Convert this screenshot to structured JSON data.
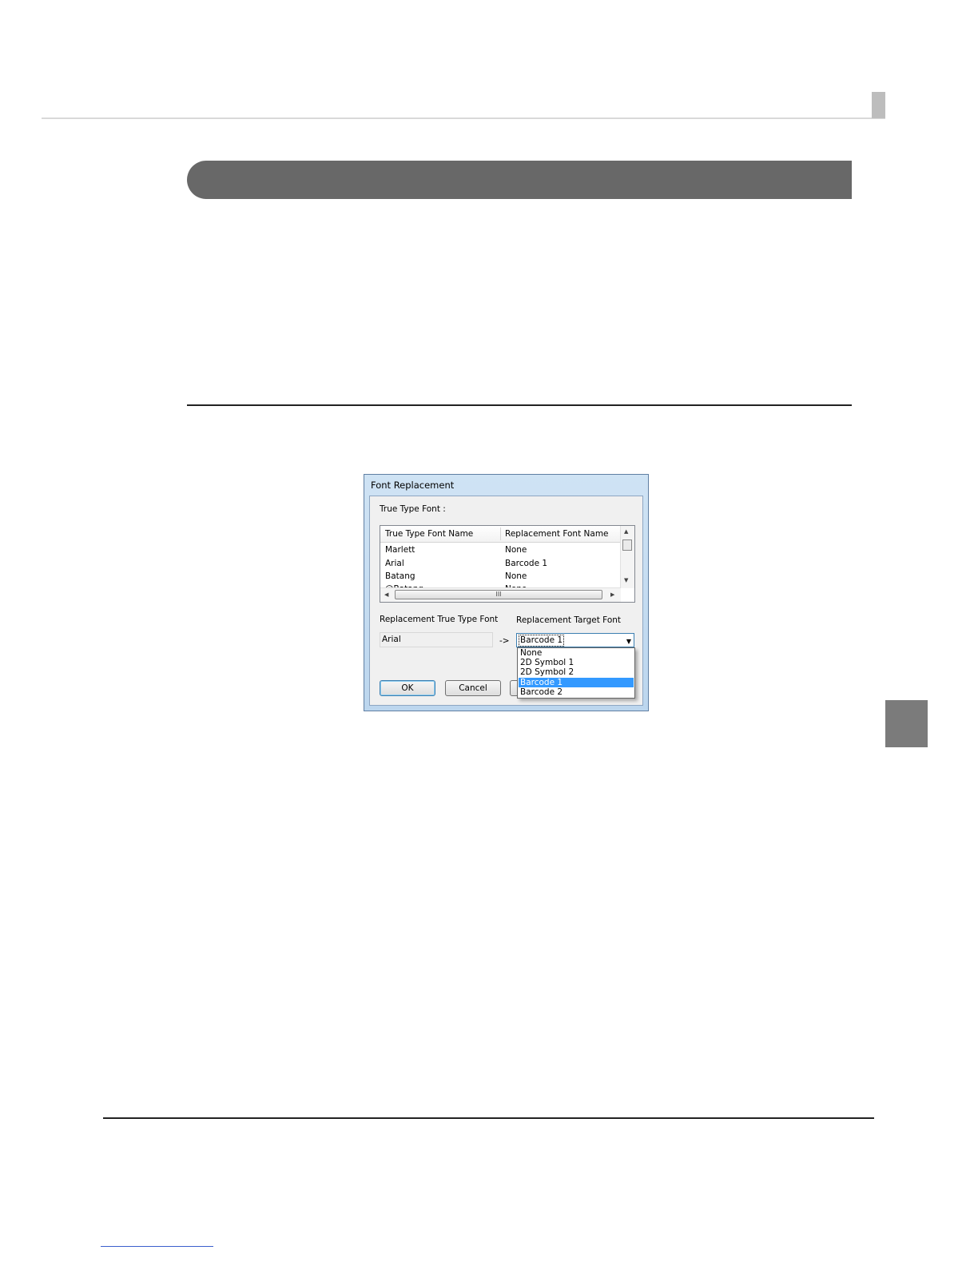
{
  "dialog": {
    "title": "Font Replacement",
    "group_label": "True Type Font :",
    "list": {
      "columns": [
        "True Type Font Name",
        "Replacement Font Name"
      ],
      "rows": [
        {
          "font": "Marlett",
          "replacement": "None"
        },
        {
          "font": "Arial",
          "replacement": "Barcode 1"
        },
        {
          "font": "Batang",
          "replacement": "None"
        },
        {
          "font": "@Batang",
          "replacement": "None"
        }
      ],
      "hscroll_grip": "III"
    },
    "replacement_ttf_label": "Replacement True Type Font",
    "replacement_ttf_value": "Arial",
    "arrow_text": "->",
    "target_label": "Replacement Target Font",
    "target_value": "Barcode 1",
    "target_options": [
      "None",
      "2D Symbol 1",
      "2D Symbol 2",
      "Barcode 1",
      "Barcode 2"
    ],
    "target_selected": "Barcode 1",
    "ok_label": "OK",
    "cancel_label": "Cancel"
  },
  "colors": {
    "section_bar": "#686868",
    "selection": "#3399ff",
    "side_tab": "#7b7b7b"
  }
}
